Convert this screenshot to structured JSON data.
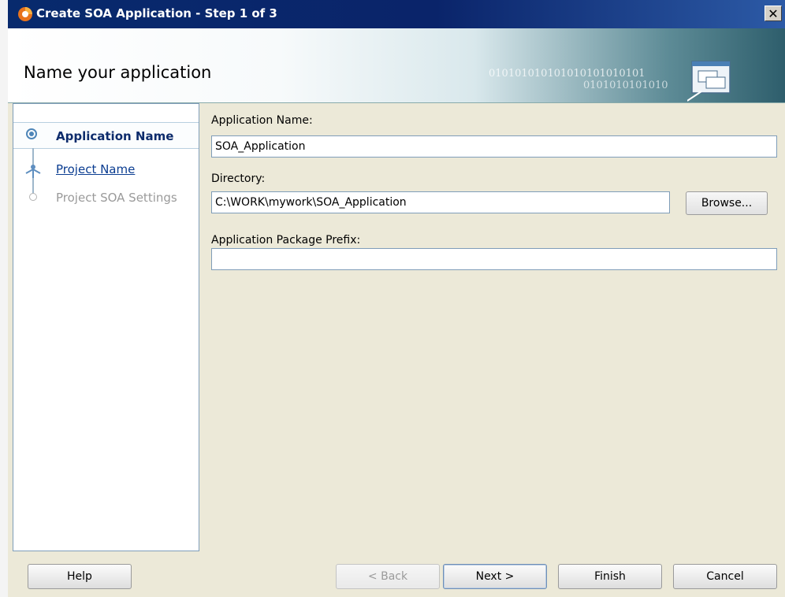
{
  "window": {
    "title": "Create SOA Application - Step 1 of 3",
    "close_glyph": "✕"
  },
  "banner": {
    "title": "Name your application",
    "binary_text": "010101010101010101010101",
    "binary_text2": "0101010101010"
  },
  "steps": [
    {
      "label": "Application Name",
      "state": "current"
    },
    {
      "label": "Project Name",
      "state": "link"
    },
    {
      "label": "Project SOA Settings",
      "state": "disabled"
    }
  ],
  "form": {
    "app_name_label": "Application Name:",
    "app_name_value": "SOA_Application",
    "directory_label": "Directory:",
    "directory_value": "C:\\WORK\\mywork\\SOA_Application",
    "browse_label": "Browse...",
    "prefix_label": "Application Package Prefix:",
    "prefix_value": ""
  },
  "buttons": {
    "help": "Help",
    "back": "< Back",
    "next": "Next >",
    "finish": "Finish",
    "cancel": "Cancel"
  },
  "icons": {
    "title_icon": "oracle-app-icon",
    "banner_icon": "application-windows-icon"
  },
  "colors": {
    "titlebar": "#0a246a",
    "accent": "#0e2c6c",
    "link": "#0b3d91"
  }
}
